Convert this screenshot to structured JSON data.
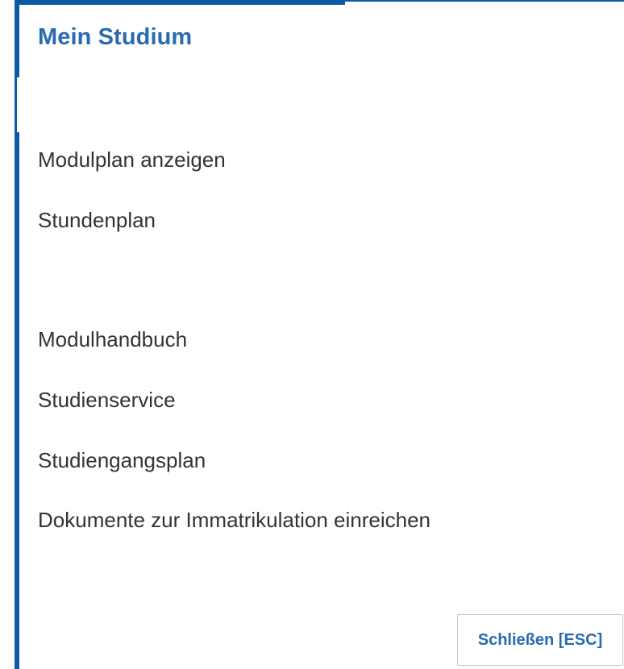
{
  "dialog": {
    "title": "Mein Studium",
    "accent_color": "#0a5aa8",
    "title_color": "#2a6bb0"
  },
  "menu": {
    "items": [
      {
        "label": "Modulplan anzeigen"
      },
      {
        "label": "Stundenplan"
      },
      {
        "label": "Modulhandbuch"
      },
      {
        "label": "Studienservice"
      },
      {
        "label": "Studiengangsplan"
      },
      {
        "label": "Dokumente zur Immatrikulation einreichen"
      }
    ]
  },
  "footer": {
    "close_label": "Schließen [ESC]"
  }
}
